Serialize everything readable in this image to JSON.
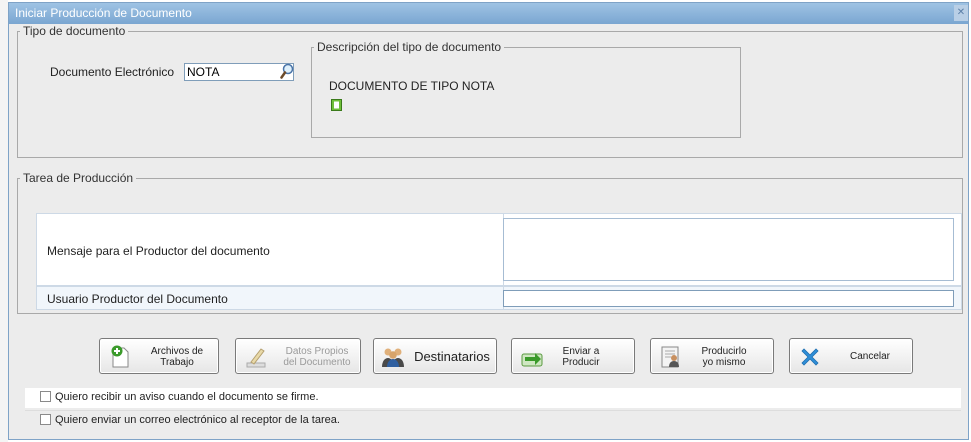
{
  "window": {
    "title": "Iniciar Producción de Documento",
    "close_symbol": "✕"
  },
  "tipo_documento": {
    "legend": "Tipo de documento",
    "field_label": "Documento Electrónico",
    "field_value": "NOTA",
    "search_icon": "magnifier-icon",
    "descripcion": {
      "legend": "Descripción del tipo de documento",
      "text": "DOCUMENTO DE TIPO NOTA",
      "icon": "document-icon"
    }
  },
  "tarea": {
    "legend": "Tarea de Producción",
    "mensaje_label": "Mensaje para el Productor del documento",
    "mensaje_value": "",
    "usuario_label": "Usuario Productor del Documento",
    "usuario_value": ""
  },
  "buttons": {
    "archivos": {
      "line1": "Archivos de",
      "line2": "Trabajo",
      "icon": "add-document-icon"
    },
    "datos": {
      "line1": "Datos Propios",
      "line2": "del Documento",
      "icon": "edit-document-icon",
      "disabled": true
    },
    "destinatarios": {
      "label": "Destinatarios",
      "icon": "people-icon"
    },
    "enviar": {
      "line1": "Enviar a",
      "line2": "Producir",
      "icon": "send-icon"
    },
    "producir": {
      "line1": "Producirlo",
      "line2": "yo mismo",
      "icon": "person-document-icon"
    },
    "cancelar": {
      "label": "Cancelar",
      "icon": "cancel-x-icon"
    }
  },
  "checkboxes": {
    "aviso_firma": {
      "label": "Quiero recibir un aviso cuando el documento se firme.",
      "checked": false
    },
    "correo": {
      "label": "Quiero enviar un correo electrónico al receptor de la tarea.",
      "checked": false
    }
  },
  "colors": {
    "titlebar": "#8fb5dc",
    "accent_green": "#3a9a2a",
    "cancel_blue": "#2f8fd8"
  }
}
